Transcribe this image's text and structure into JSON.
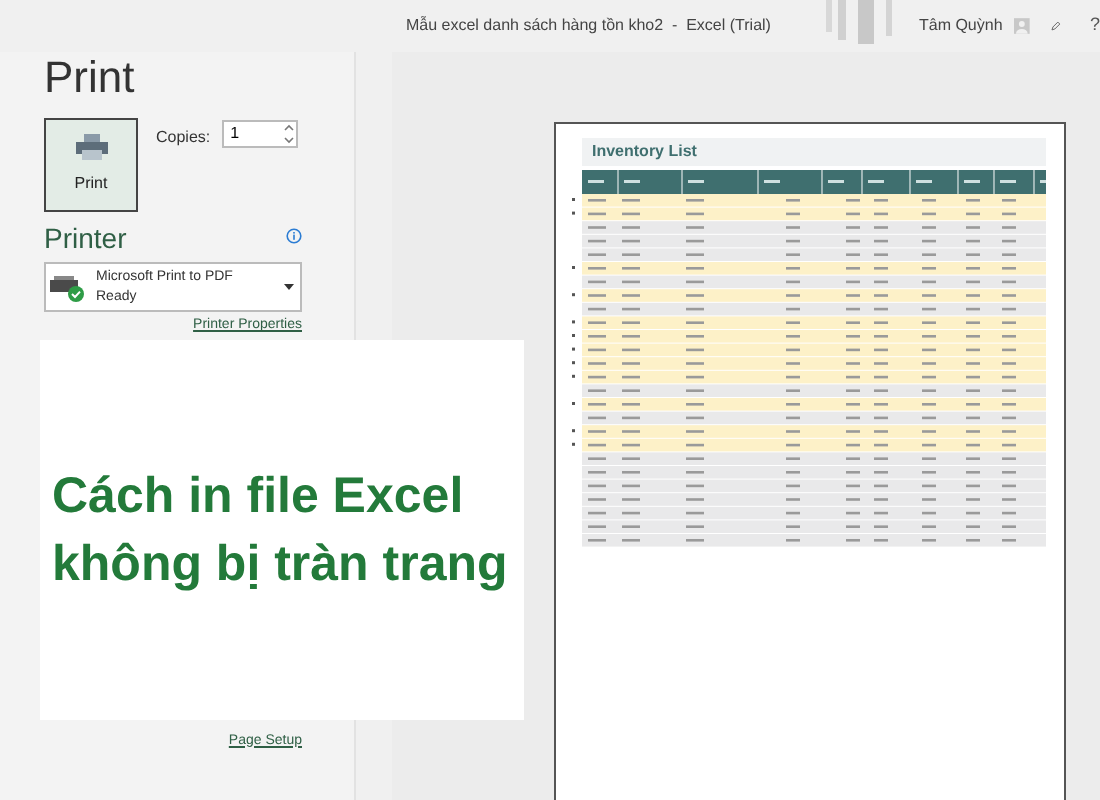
{
  "window": {
    "title": "Mẫu excel danh sách hàng tồn kho2  -  Excel (Trial)",
    "user": "Tâm Quỳnh",
    "help": "?"
  },
  "print": {
    "heading": "Print",
    "button": "Print",
    "copies_label": "Copies:",
    "copies": "1"
  },
  "printer": {
    "heading": "Printer",
    "name": "Microsoft Print to PDF",
    "status": "Ready",
    "properties_link": "Printer Properties"
  },
  "page_setup_link": "Page Setup",
  "overlay": {
    "lines": [
      "Cách in file Excel",
      "không bị tràn trang"
    ]
  },
  "preview": {
    "title": "Inventory List",
    "rows": [
      {
        "highlighted": true
      },
      {
        "highlighted": true
      },
      {
        "highlighted": false
      },
      {
        "highlighted": false
      },
      {
        "highlighted": false
      },
      {
        "highlighted": true
      },
      {
        "highlighted": false
      },
      {
        "highlighted": true
      },
      {
        "highlighted": false
      },
      {
        "highlighted": true
      },
      {
        "highlighted": true
      },
      {
        "highlighted": true
      },
      {
        "highlighted": true
      },
      {
        "highlighted": true
      },
      {
        "highlighted": false
      },
      {
        "highlighted": true
      },
      {
        "highlighted": false
      },
      {
        "highlighted": true
      },
      {
        "highlighted": true
      },
      {
        "highlighted": false
      },
      {
        "highlighted": false
      },
      {
        "highlighted": false
      },
      {
        "highlighted": false
      },
      {
        "highlighted": false
      },
      {
        "highlighted": false
      },
      {
        "highlighted": false
      }
    ]
  }
}
